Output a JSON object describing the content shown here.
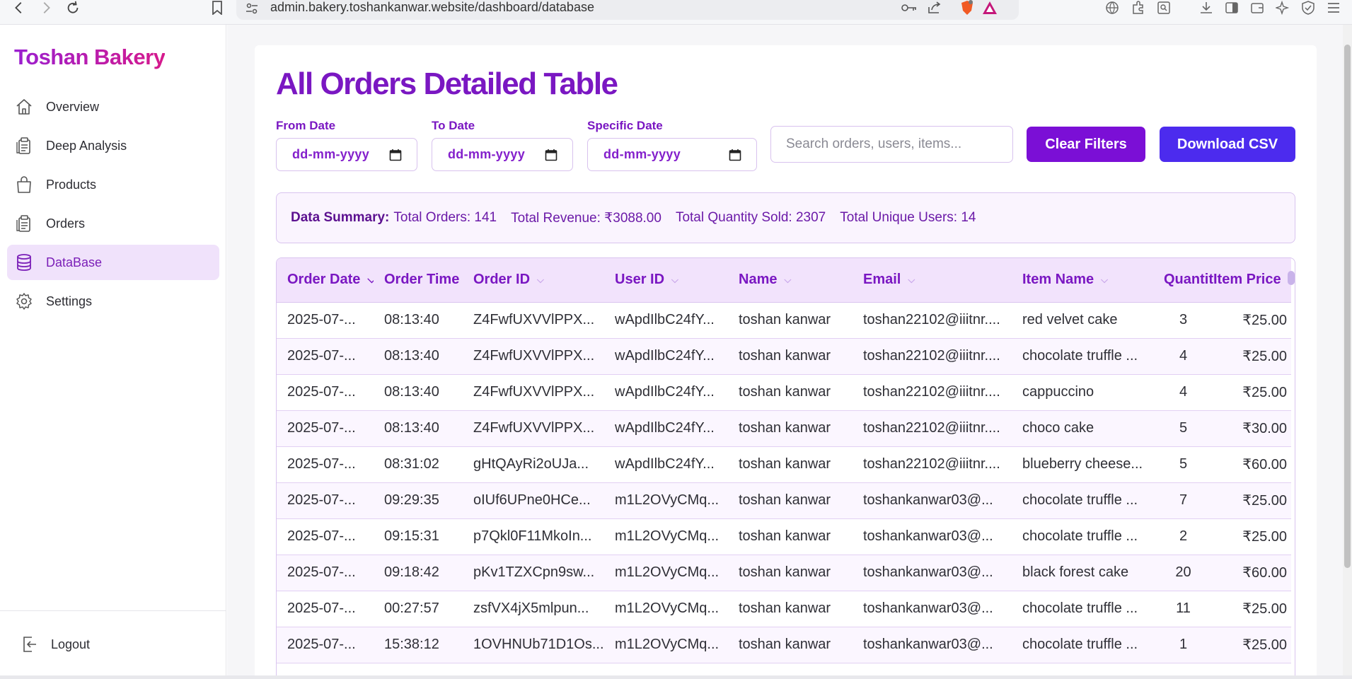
{
  "browser": {
    "url": "admin.bakery.toshankanwar.website/dashboard/database"
  },
  "sidebar": {
    "brand": "Toshan Bakery",
    "items": [
      {
        "label": "Overview",
        "icon": "home-icon"
      },
      {
        "label": "Deep Analysis",
        "icon": "clipboard-icon"
      },
      {
        "label": "Products",
        "icon": "shopping-bag-icon"
      },
      {
        "label": "Orders",
        "icon": "clipboard-icon"
      },
      {
        "label": "DataBase",
        "icon": "database-icon"
      },
      {
        "label": "Settings",
        "icon": "gear-icon"
      }
    ],
    "logout": "Logout"
  },
  "page": {
    "title": "All Orders Detailed Table"
  },
  "filters": {
    "from_label": "From Date",
    "to_label": "To Date",
    "specific_label": "Specific Date",
    "date_placeholder": "dd-mm-yyyy",
    "search_placeholder": "Search orders, users, items...",
    "clear_button": "Clear Filters",
    "download_button": "Download CSV"
  },
  "summary": {
    "heading": "Data Summary:",
    "total_orders": "Total Orders: 141",
    "total_revenue": "Total Revenue: ₹3088.00",
    "total_quantity": "Total Quantity Sold: 2307",
    "total_users": "Total Unique Users: 14"
  },
  "table": {
    "columns": [
      "Order Date",
      "Order Time",
      "Order ID",
      "User ID",
      "Name",
      "Email",
      "Item Name",
      "Quantity",
      "Item Price"
    ],
    "rows": [
      [
        "2025-07-...",
        "08:13:40",
        "Z4FwfUXVVlPPX...",
        "wApdIlbC24fY...",
        "toshan kanwar",
        "toshan22102@iiitnr....",
        "red velvet cake",
        "3",
        "₹25.00"
      ],
      [
        "2025-07-...",
        "08:13:40",
        "Z4FwfUXVVlPPX...",
        "wApdIlbC24fY...",
        "toshan kanwar",
        "toshan22102@iiitnr....",
        "chocolate truffle ...",
        "4",
        "₹25.00"
      ],
      [
        "2025-07-...",
        "08:13:40",
        "Z4FwfUXVVlPPX...",
        "wApdIlbC24fY...",
        "toshan kanwar",
        "toshan22102@iiitnr....",
        "cappuccino",
        "4",
        "₹25.00"
      ],
      [
        "2025-07-...",
        "08:13:40",
        "Z4FwfUXVVlPPX...",
        "wApdIlbC24fY...",
        "toshan kanwar",
        "toshan22102@iiitnr....",
        "choco cake",
        "5",
        "₹30.00"
      ],
      [
        "2025-07-...",
        "08:31:02",
        "gHtQAyRi2oUJa...",
        "wApdIlbC24fY...",
        "toshan kanwar",
        "toshan22102@iiitnr....",
        "blueberry cheese...",
        "5",
        "₹60.00"
      ],
      [
        "2025-07-...",
        "09:29:35",
        "oIUf6UPne0HCe...",
        "m1L2OVyCMq...",
        "toshan kanwar",
        "toshankanwar03@...",
        "chocolate truffle ...",
        "7",
        "₹25.00"
      ],
      [
        "2025-07-...",
        "09:15:31",
        "p7Qkl0F11MkoIn...",
        "m1L2OVyCMq...",
        "toshan kanwar",
        "toshankanwar03@...",
        "chocolate truffle ...",
        "2",
        "₹25.00"
      ],
      [
        "2025-07-...",
        "09:18:42",
        "pKv1TZXCpn9sw...",
        "m1L2OVyCMq...",
        "toshan kanwar",
        "toshankanwar03@...",
        "black forest cake",
        "20",
        "₹60.00"
      ],
      [
        "2025-07-...",
        "00:27:57",
        "zsfVX4jX5mlpun...",
        "m1L2OVyCMq...",
        "toshan kanwar",
        "toshankanwar03@...",
        "chocolate truffle ...",
        "11",
        "₹25.00"
      ],
      [
        "2025-07-...",
        "15:38:12",
        "1OVHNUb71D1Os...",
        "m1L2OVyCMq...",
        "toshan kanwar",
        "toshankanwar03@...",
        "chocolate truffle ...",
        "1",
        "₹25.00"
      ]
    ]
  },
  "colors": {
    "accent": "#7a17c2",
    "clear_button": "#7b0fd6",
    "download_button": "#4c2bee",
    "active_nav_bg": "#f0e2fb"
  }
}
